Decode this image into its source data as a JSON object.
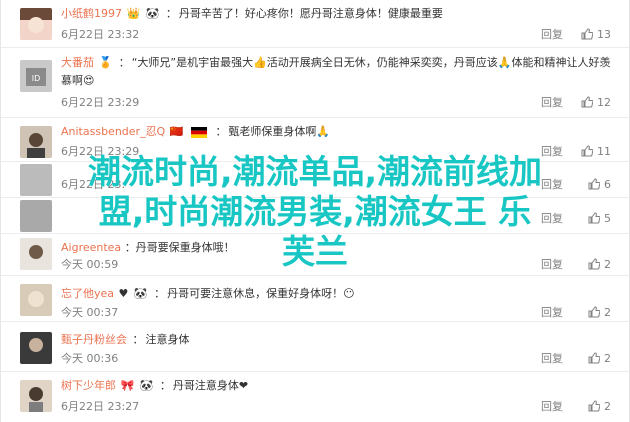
{
  "comments": [
    {
      "name": "小纸鹤1997",
      "emoji1": "🐼",
      "text": "丹哥辛苦了！好心疼你！愿丹哥注意身体！健康最重要",
      "time": "6月22日 23:32",
      "reply": "回复",
      "likes": "13"
    },
    {
      "name": "大番茄",
      "emoji1": "🏅",
      "text": "“大师兄”是机宇宙最强大👍活动开展病全日无休，仍能神采奕奕，丹哥应该🙏体能和精神让人好羡慕啊😍",
      "time": "6月22日 23:29",
      "reply": "回复",
      "likes": "12"
    },
    {
      "name": "Anitassbender_忍Q",
      "text": "甄老师保重身体啊🙏",
      "time": "6月22日 23:29",
      "reply": "回复",
      "likes": "11"
    },
    {
      "name": "",
      "text": "",
      "time": "6月22日 23:",
      "reply": "回复",
      "likes": "6"
    },
    {
      "name": "",
      "text": "",
      "time": "",
      "reply": "回复",
      "likes": "5"
    },
    {
      "name": "Aigreentea",
      "text": "：丹哥要保重身体哦！",
      "time": "今天 00:59",
      "reply": "回复",
      "likes": "2"
    },
    {
      "name": "忘了他yea",
      "emoji1": "🐼",
      "text": "丹哥可要注意休息，保重好身体呀！😶",
      "time": "今天 00:37",
      "reply": "回复",
      "likes": "2"
    },
    {
      "name": "甄子丹粉丝会",
      "text": "注意身体",
      "time": "今天 00:36",
      "reply": "回复",
      "likes": "2"
    },
    {
      "name": "树下少年郎",
      "emoji1": "🐼",
      "text": "丹哥注意身体❤",
      "time": "6月22日 23:27",
      "reply": "回复",
      "likes": "2"
    }
  ],
  "overlay": {
    "line1": "潮流时尚,潮流单品,潮流前线加",
    "line2": "盟,时尚潮流男装,潮流女王 乐",
    "line3": "芙兰"
  },
  "colors": {
    "username": "#eb7350",
    "overlay": "#18c7c3",
    "meta": "#808080"
  }
}
